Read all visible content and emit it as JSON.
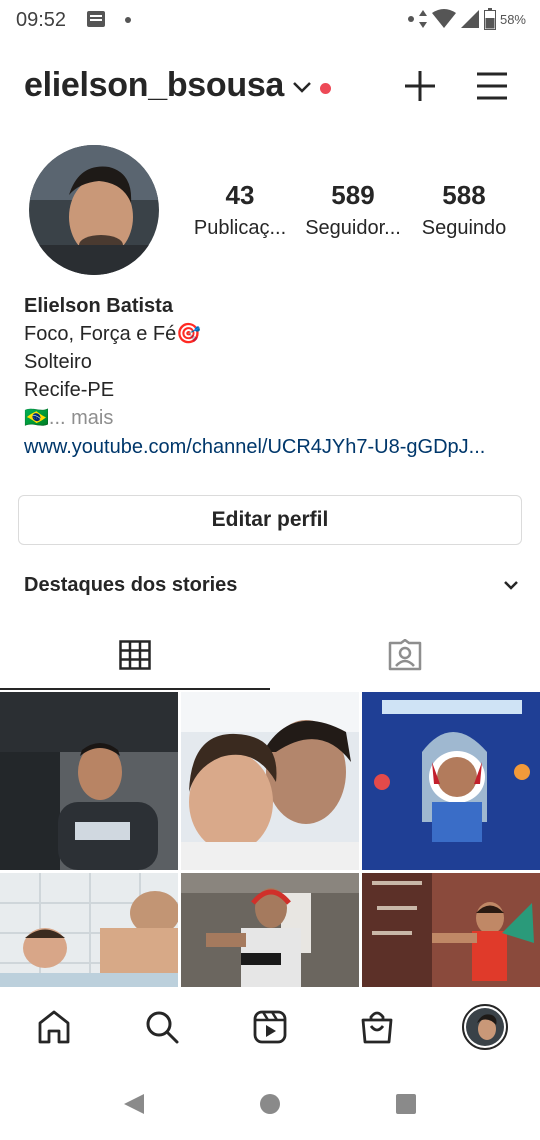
{
  "status_bar": {
    "time": "09:52",
    "battery": "58%"
  },
  "header": {
    "username": "elielson_bsousa"
  },
  "profile": {
    "stats": [
      {
        "value": "43",
        "label": "Publicaç..."
      },
      {
        "value": "589",
        "label": "Seguidor..."
      },
      {
        "value": "588",
        "label": "Seguindo"
      }
    ],
    "name": "Elielson Batista",
    "bio_lines": [
      "Foco, Força e Fé🎯",
      "Solteiro",
      "Recife-PE"
    ],
    "bio_flag": "🇧🇷",
    "bio_more": "... mais",
    "link": "www.youtube.com/channel/UCR4JYh7-U8-gGDpJ..."
  },
  "buttons": {
    "edit_profile": "Editar perfil"
  },
  "highlights": {
    "title": "Destaques dos stories"
  },
  "tabs": [
    {
      "icon": "grid-icon",
      "active": true
    },
    {
      "icon": "tagged-icon",
      "active": false
    }
  ],
  "posts": [
    {
      "description": "selfie-in-car"
    },
    {
      "description": "selfie-with-child"
    },
    {
      "description": "child-shark-frame"
    },
    {
      "description": "pool-with-child"
    },
    {
      "description": "shooting-range"
    },
    {
      "description": "child-with-toy"
    }
  ],
  "bottom_nav": [
    {
      "icon": "home-icon"
    },
    {
      "icon": "search-icon"
    },
    {
      "icon": "reels-icon"
    },
    {
      "icon": "shop-icon"
    },
    {
      "icon": "profile-avatar-icon"
    }
  ],
  "colors": {
    "text": "#262626",
    "link": "#00376b",
    "notification_dot": "#ed4956",
    "border": "#dbdbdb",
    "muted": "#8e8e8e"
  }
}
